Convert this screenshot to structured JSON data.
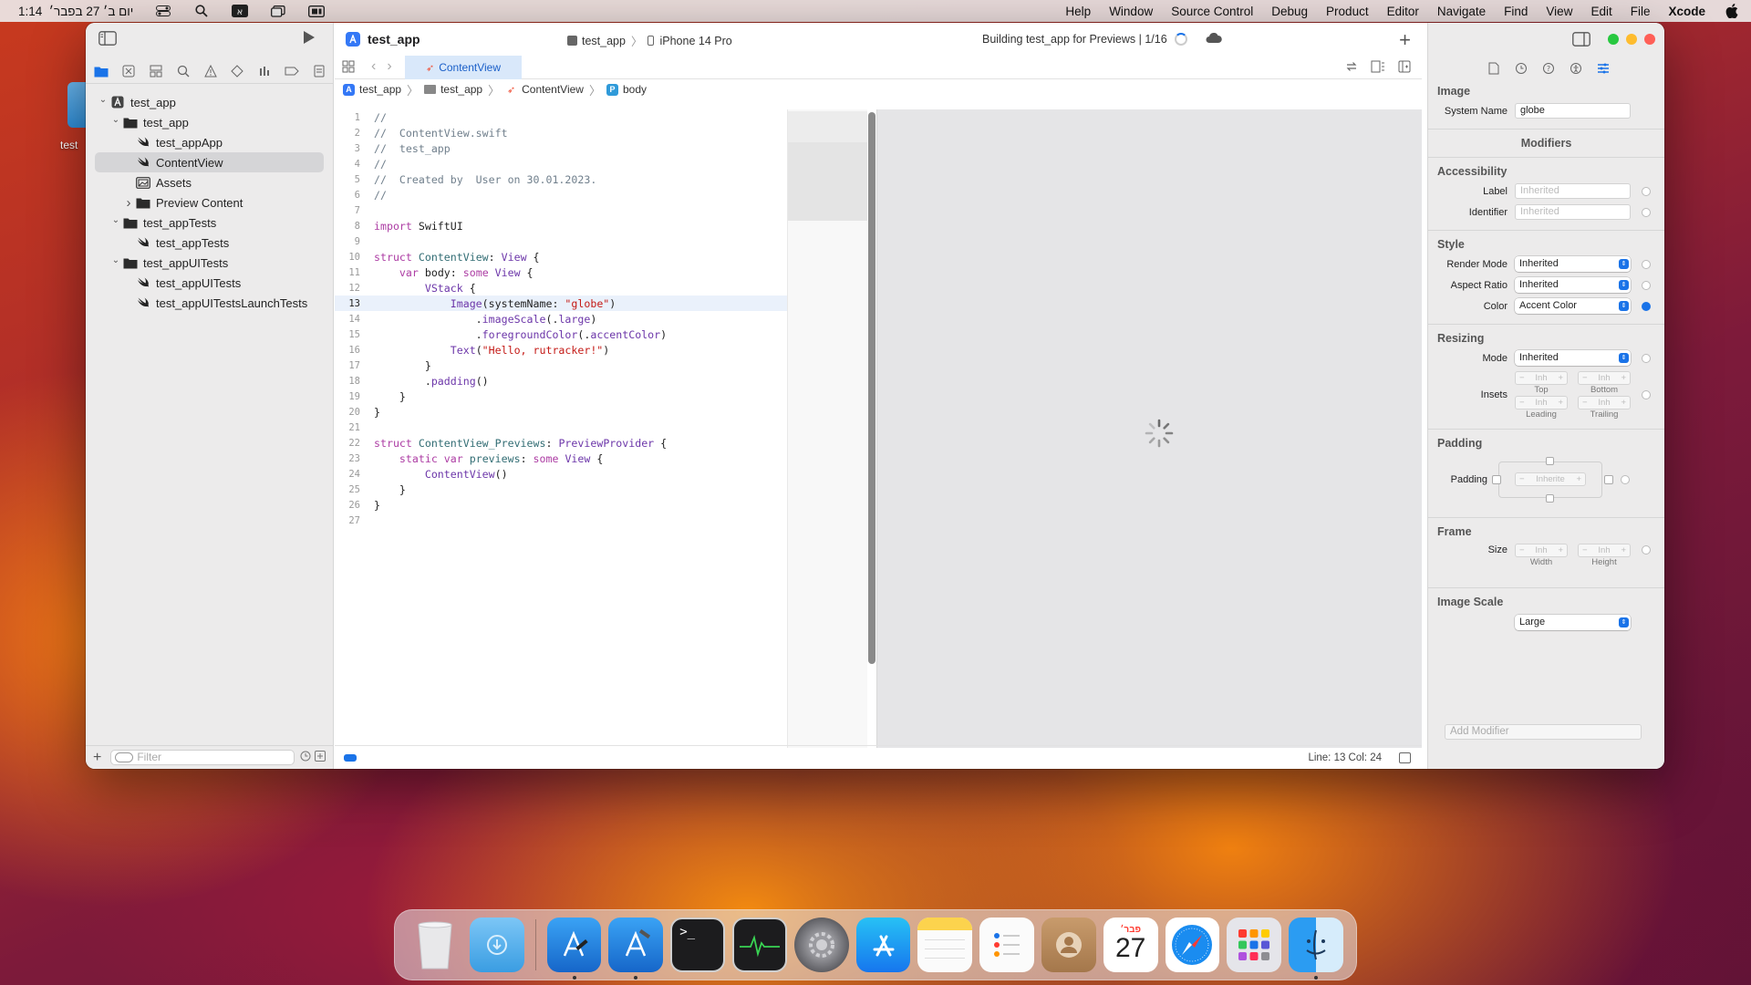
{
  "menubar": {
    "left": {
      "time": "1:14",
      "date": "יום ב׳ 27 בפבר׳"
    },
    "right_items": [
      "Help",
      "Window",
      "Source Control",
      "Debug",
      "Product",
      "Editor",
      "Navigate",
      "Find",
      "View",
      "Edit",
      "File"
    ],
    "app_name": "Xcode"
  },
  "desktop": {
    "icon_label": "test"
  },
  "navigator": {
    "tree": [
      {
        "label": "test_app",
        "depth": 0,
        "icon": "project-icon",
        "chevron": "open"
      },
      {
        "label": "test_app",
        "depth": 1,
        "icon": "folder-icon",
        "chevron": "open"
      },
      {
        "label": "test_appApp",
        "depth": 2,
        "icon": "swift-icon",
        "chevron": ""
      },
      {
        "label": "ContentView",
        "depth": 2,
        "icon": "swift-icon",
        "chevron": "",
        "selected": true
      },
      {
        "label": "Assets",
        "depth": 2,
        "icon": "assets-icon",
        "chevron": ""
      },
      {
        "label": "Preview Content",
        "depth": 2,
        "icon": "folder-icon",
        "chevron": "closed"
      },
      {
        "label": "test_appTests",
        "depth": 1,
        "icon": "folder-icon",
        "chevron": "open"
      },
      {
        "label": "test_appTests",
        "depth": 2,
        "icon": "swift-icon",
        "chevron": ""
      },
      {
        "label": "test_appUITests",
        "depth": 1,
        "icon": "folder-icon",
        "chevron": "open"
      },
      {
        "label": "test_appUITests",
        "depth": 2,
        "icon": "swift-icon",
        "chevron": ""
      },
      {
        "label": "test_appUITestsLaunchTests",
        "depth": 2,
        "icon": "swift-icon",
        "chevron": ""
      }
    ],
    "filter_placeholder": "Filter"
  },
  "toolbar": {
    "project_title": "test_app",
    "scheme": "test_app",
    "destination": "iPhone 14 Pro",
    "status": "Building test_app for Previews | 1/16"
  },
  "tabs": {
    "active_file": "ContentView"
  },
  "jumpbar": [
    "test_app",
    "test_app",
    "ContentView",
    "body"
  ],
  "code": {
    "current_line": 13,
    "lines": [
      [
        [
          "cm",
          "//"
        ]
      ],
      [
        [
          "cm",
          "//  ContentView.swift"
        ]
      ],
      [
        [
          "cm",
          "//  test_app"
        ]
      ],
      [
        [
          "cm",
          "//"
        ]
      ],
      [
        [
          "cm",
          "//  Created by  User on 30.01.2023."
        ]
      ],
      [
        [
          "cm",
          "//"
        ]
      ],
      [],
      [
        [
          "kw",
          "import"
        ],
        [
          "",
          " SwiftUI"
        ]
      ],
      [],
      [
        [
          "kw",
          "struct"
        ],
        [
          "",
          " "
        ],
        [
          "fn",
          "ContentView"
        ],
        [
          "",
          ": "
        ],
        [
          "mth",
          "View"
        ],
        [
          "",
          " {"
        ]
      ],
      [
        [
          "",
          "    "
        ],
        [
          "kw",
          "var"
        ],
        [
          "",
          " body: "
        ],
        [
          "kw",
          "some"
        ],
        [
          "",
          " "
        ],
        [
          "mth",
          "View"
        ],
        [
          "",
          " {"
        ]
      ],
      [
        [
          "",
          "        "
        ],
        [
          "mth",
          "VStack"
        ],
        [
          "",
          " {"
        ]
      ],
      [
        [
          "",
          "            "
        ],
        [
          "mth",
          "Image"
        ],
        [
          "",
          "(systemName: "
        ],
        [
          "str",
          "\"globe\""
        ],
        [
          "",
          ")"
        ]
      ],
      [
        [
          "",
          "                ."
        ],
        [
          "mth",
          "imageScale"
        ],
        [
          "",
          "(."
        ],
        [
          "mth",
          "large"
        ],
        [
          "",
          ")"
        ]
      ],
      [
        [
          "",
          "                ."
        ],
        [
          "mth",
          "foregroundColor"
        ],
        [
          "",
          "(."
        ],
        [
          "mth",
          "accentColor"
        ],
        [
          "",
          ")"
        ]
      ],
      [
        [
          "",
          "            "
        ],
        [
          "mth",
          "Text"
        ],
        [
          "",
          "("
        ],
        [
          "str",
          "\"Hello, rutracker!\""
        ],
        [
          "",
          ")"
        ]
      ],
      [
        [
          "",
          "        }"
        ]
      ],
      [
        [
          "",
          "        ."
        ],
        [
          "mth",
          "padding"
        ],
        [
          "",
          "()"
        ]
      ],
      [
        [
          "",
          "    }"
        ]
      ],
      [
        [
          "",
          "}"
        ]
      ],
      [],
      [
        [
          "kw",
          "struct"
        ],
        [
          "",
          " "
        ],
        [
          "fn",
          "ContentView_Previews"
        ],
        [
          "",
          ": "
        ],
        [
          "mth",
          "PreviewProvider"
        ],
        [
          "",
          " {"
        ]
      ],
      [
        [
          "",
          "    "
        ],
        [
          "kw",
          "static"
        ],
        [
          "",
          " "
        ],
        [
          "kw",
          "var"
        ],
        [
          "",
          " "
        ],
        [
          "fn",
          "previews"
        ],
        [
          "",
          ": "
        ],
        [
          "kw",
          "some"
        ],
        [
          "",
          " "
        ],
        [
          "mth",
          "View"
        ],
        [
          "",
          " {"
        ]
      ],
      [
        [
          "",
          "        "
        ],
        [
          "mth",
          "ContentView"
        ],
        [
          "",
          "()"
        ]
      ],
      [
        [
          "",
          "    }"
        ]
      ],
      [
        [
          "",
          "}"
        ]
      ],
      []
    ]
  },
  "footer": {
    "position": "Line: 13  Col: 24"
  },
  "inspector": {
    "image_header": "Image",
    "system_name_label": "System Name",
    "system_name_value": "globe",
    "modifiers_header": "Modifiers",
    "accessibility_header": "Accessibility",
    "label_label": "Label",
    "label_placeholder": "Inherited",
    "identifier_label": "Identifier",
    "identifier_placeholder": "Inherited",
    "style_header": "Style",
    "render_mode_label": "Render Mode",
    "render_mode_value": "Inherited",
    "aspect_ratio_label": "Aspect Ratio",
    "aspect_ratio_value": "Inherited",
    "color_label": "Color",
    "color_value": "Accent Color",
    "resizing_header": "Resizing",
    "mode_label": "Mode",
    "mode_value": "Inherited",
    "insets_label": "Insets",
    "inset_placeholder": "Inh",
    "top_label": "Top",
    "bottom_label": "Bottom",
    "leading_label": "Leading",
    "trailing_label": "Trailing",
    "padding_header": "Padding",
    "padding_label": "Padding",
    "padding_placeholder": "Inherite",
    "frame_header": "Frame",
    "size_label": "Size",
    "width_label": "Width",
    "height_label": "Height",
    "image_scale_header": "Image Scale",
    "image_scale_value": "Large",
    "add_modifier_placeholder": "Add Modifier"
  },
  "dock": {
    "items": [
      "trash-icon",
      "downloads-folder-icon",
      "xcode-beta-icon",
      "xcode-icon",
      "terminal-icon",
      "activity-monitor-icon",
      "system-settings-icon",
      "app-store-icon",
      "notes-icon",
      "reminders-icon",
      "contacts-icon",
      "calendar-icon",
      "safari-icon",
      "launchpad-icon",
      "finder-icon"
    ],
    "calendar_month": "פבר׳",
    "calendar_day": "27"
  },
  "colors": {
    "accent": "#1a73e8",
    "close": "#ff5f57",
    "minimize": "#febc2e",
    "zoom": "#28c840"
  }
}
